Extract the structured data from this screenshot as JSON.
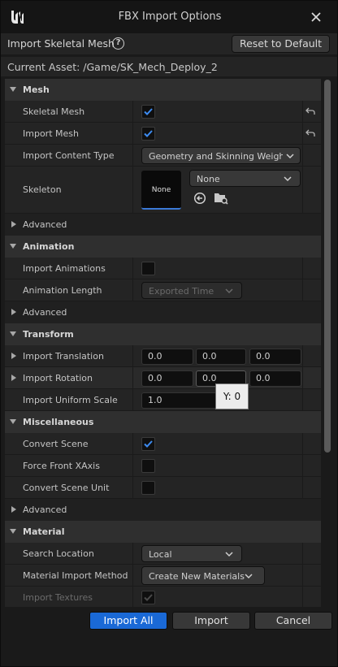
{
  "window": {
    "title": "FBX Import Options"
  },
  "header": {
    "label": "Import Skeletal Mesh",
    "reset_label": "Reset to Default"
  },
  "asset": {
    "label": "Current Asset:  /Game/SK_Mech_Deploy_2"
  },
  "mesh": {
    "category": "Mesh",
    "skeletal_mesh": {
      "label": "Skeletal Mesh",
      "checked": true
    },
    "import_mesh": {
      "label": "Import Mesh",
      "checked": true
    },
    "import_content_type": {
      "label": "Import Content Type",
      "value": "Geometry and Skinning Weights."
    },
    "skeleton": {
      "label": "Skeleton",
      "thumb": "None",
      "value": "None"
    },
    "advanced": "Advanced"
  },
  "animation": {
    "category": "Animation",
    "import_animations": {
      "label": "Import Animations",
      "checked": false
    },
    "animation_length": {
      "label": "Animation Length",
      "value": "Exported Time"
    },
    "advanced": "Advanced"
  },
  "transform": {
    "category": "Transform",
    "import_translation": {
      "label": "Import Translation",
      "x": "0.0",
      "y": "0.0",
      "z": "0.0"
    },
    "import_rotation": {
      "label": "Import Rotation",
      "x": "0.0",
      "y": "0.0",
      "z": "0.0"
    },
    "import_uniform_scale": {
      "label": "Import Uniform Scale",
      "value": "1.0"
    }
  },
  "miscellaneous": {
    "category": "Miscellaneous",
    "convert_scene": {
      "label": "Convert Scene",
      "checked": true
    },
    "force_front_xaxis": {
      "label": "Force Front XAxis",
      "checked": false
    },
    "convert_scene_unit": {
      "label": "Convert Scene Unit",
      "checked": false
    },
    "advanced": "Advanced"
  },
  "material": {
    "category": "Material",
    "search_location": {
      "label": "Search Location",
      "value": "Local"
    },
    "material_import_method": {
      "label": "Material Import Method",
      "value": "Create New Materials"
    },
    "import_textures": {
      "label": "Import Textures",
      "checked": true
    }
  },
  "tooltip": {
    "text": "Y: 0"
  },
  "footer": {
    "import_all": "Import All",
    "import": "Import",
    "cancel": "Cancel"
  },
  "colors": {
    "accent": "#1a69d6",
    "background": "#1a1a1a",
    "row": "#242424",
    "category": "#2f2f2f"
  }
}
